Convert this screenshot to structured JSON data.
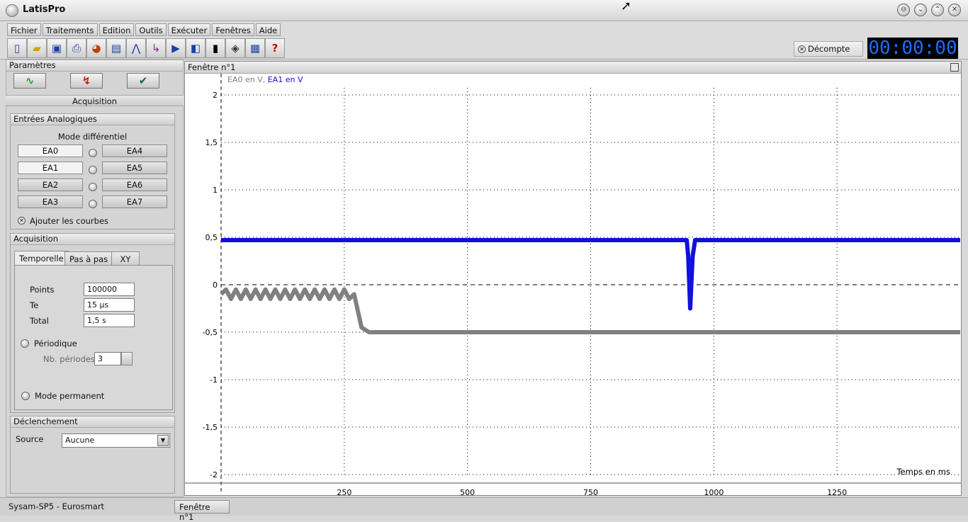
{
  "window": {
    "title": "LatisPro",
    "controls": [
      "⊖",
      "⌄",
      "⌃",
      "✕"
    ]
  },
  "menu": [
    "Fichier",
    "Traitements",
    "Edition",
    "Outils",
    "Exécuter",
    "Fenêtres",
    "Aide"
  ],
  "toolbar": {
    "icons": [
      "new-file-icon",
      "open-folder-icon",
      "save-icon",
      "print-icon",
      "palette-icon",
      "table-icon",
      "curve-icon",
      "axes-icon",
      "play-icon",
      "sound-icon",
      "device-icon",
      "tag-icon",
      "calculator-icon",
      "help-icon"
    ],
    "decompte_label": "Décompte",
    "timer": "00:00:00",
    "accent_blue": "#1a6dff"
  },
  "left": {
    "params_title": "Paramètres",
    "acquisition_title": "Acquisition",
    "inputs": {
      "title": "Entrées Analogiques",
      "mode": "Mode différentiel",
      "left_channels": [
        "EA0",
        "EA1",
        "EA2",
        "EA3"
      ],
      "right_channels": [
        "EA4",
        "EA5",
        "EA6",
        "EA7"
      ],
      "add_curves": "Ajouter les courbes"
    },
    "acq": {
      "title": "Acquisition",
      "tabs": [
        "Temporelle",
        "Pas à pas",
        "XY"
      ],
      "points_label": "Points",
      "points_value": "100000",
      "te_label": "Te",
      "te_value": "15 µs",
      "total_label": "Total",
      "total_value": "1,5 s",
      "periodic_label": "Périodique",
      "nb_periods_label": "Nb. périodes",
      "nb_periods_value": "3",
      "permanent_label": "Mode permanent"
    },
    "trigger": {
      "title": "Déclenchement",
      "source_label": "Source",
      "source_value": "Aucune"
    }
  },
  "graph": {
    "window_title": "Fenêtre n°1",
    "legend_ea0": "EA0 en V",
    "legend_sep": ", ",
    "legend_ea1": "EA1 en V",
    "xlabel": "Temps en ms"
  },
  "status": {
    "device": "Sysam-SP5 - Eurosmart",
    "window_tab": "Fenêtre n°1"
  },
  "chart_data": {
    "type": "line",
    "xlabel": "Temps en ms",
    "ylabel": "",
    "xlim": [
      0,
      1500
    ],
    "ylim": [
      -2,
      2
    ],
    "x_ticks": [
      250,
      500,
      750,
      1000,
      1250
    ],
    "x_tick_labels": [
      "250",
      "500",
      "750",
      "1000",
      "1250"
    ],
    "y_ticks": [
      2,
      1.5,
      1,
      0.5,
      0,
      -0.5,
      -1,
      -1.5,
      -2
    ],
    "y_tick_labels": [
      "2",
      "1,5",
      "1",
      "0,5",
      "0",
      "-0,5",
      "-1",
      "-1,5",
      "-2"
    ],
    "grid": "dotted",
    "series": [
      {
        "name": "EA0 en V",
        "color": "#808080",
        "x": [
          0,
          10,
          20,
          30,
          40,
          50,
          60,
          70,
          80,
          90,
          100,
          110,
          120,
          130,
          140,
          150,
          160,
          170,
          180,
          190,
          200,
          210,
          220,
          230,
          240,
          250,
          260,
          270,
          285,
          300,
          1500
        ],
        "y": [
          -0.1,
          -0.05,
          -0.15,
          -0.05,
          -0.15,
          -0.05,
          -0.15,
          -0.05,
          -0.15,
          -0.05,
          -0.15,
          -0.05,
          -0.15,
          -0.05,
          -0.15,
          -0.05,
          -0.15,
          -0.05,
          -0.15,
          -0.05,
          -0.15,
          -0.05,
          -0.15,
          -0.05,
          -0.15,
          -0.05,
          -0.15,
          -0.1,
          -0.45,
          -0.5,
          -0.5
        ]
      },
      {
        "name": "EA1 en V",
        "color": "#1010e0",
        "x": [
          0,
          945,
          948,
          952,
          957,
          962,
          1500
        ],
        "y": [
          0.47,
          0.47,
          0.3,
          -0.25,
          0.3,
          0.47,
          0.47
        ]
      }
    ]
  }
}
